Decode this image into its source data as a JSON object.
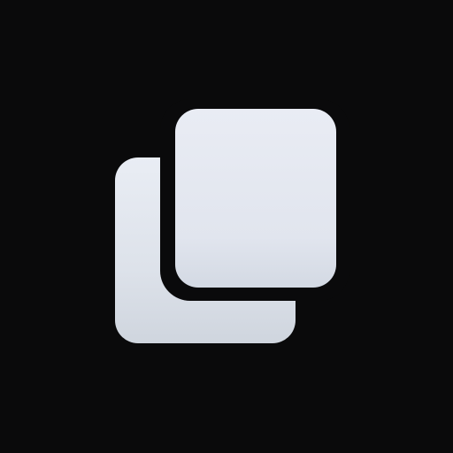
{
  "app": {
    "icon_name": "copy-icon"
  },
  "colors": {
    "background": "#0a0a0b",
    "icon_light_top": "#e8ebf2",
    "icon_light_bottom": "#cfd5de",
    "icon_gap": "#0a0a0b"
  }
}
